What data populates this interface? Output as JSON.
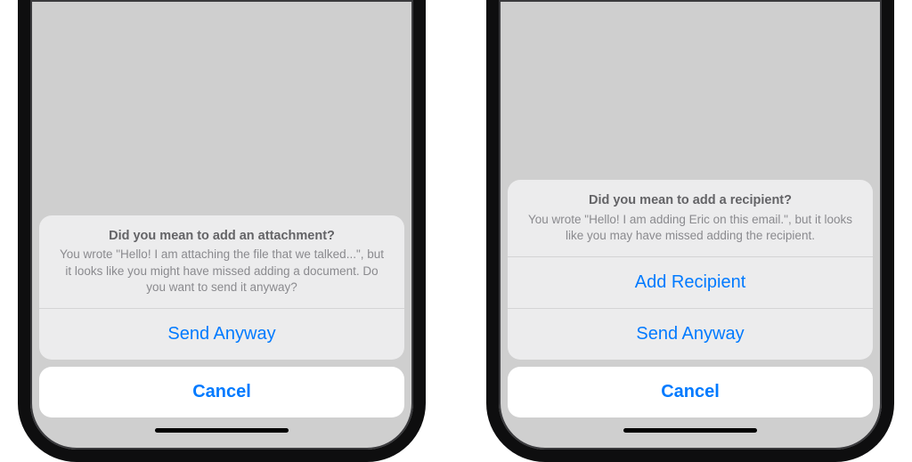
{
  "left": {
    "title": "Did you mean to add an attachment?",
    "message": "You wrote \"Hello! I am attaching the file that we talked...\", but it looks like you might have missed adding a document. Do you want to send it anyway?",
    "buttons": {
      "send_anyway": "Send Anyway",
      "cancel": "Cancel"
    }
  },
  "right": {
    "title": "Did you mean to add a recipient?",
    "message": "You wrote \"Hello! I am adding Eric on this email.\", but it looks like you may have missed adding the recipient.",
    "buttons": {
      "add_recipient": "Add Recipient",
      "send_anyway": "Send Anyway",
      "cancel": "Cancel"
    }
  }
}
